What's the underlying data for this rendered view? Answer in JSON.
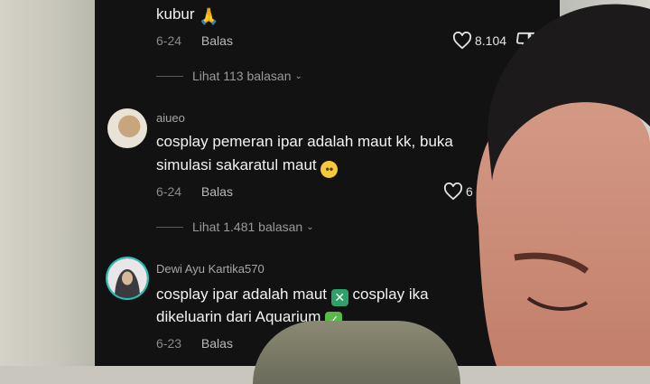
{
  "comments": [
    {
      "text_tail": "kubur",
      "date": "6-24",
      "reply_label": "Balas",
      "likes": "8.104",
      "view_replies": "Lihat 113 balasan"
    },
    {
      "username": "aiueo",
      "line1": "cosplay pemeran ipar adalah maut kk, buka",
      "line2": "simulasi sakaratul maut",
      "date": "6-24",
      "reply_label": "Balas",
      "likes": "6",
      "view_replies": "Lihat 1.481 balasan"
    },
    {
      "username": "Dewi Ayu Kartika570",
      "line1_a": "cosplay ipar adalah maut",
      "line1_b": "cosplay ika",
      "line2": "dikeluarin dari Aquarium",
      "date": "6-23",
      "reply_label": "Balas"
    }
  ],
  "icons": {
    "like": "heart-icon",
    "dislike": "thumbs-down-icon",
    "expand": "chevron-down-icon"
  },
  "colors": {
    "panel_bg": "#121212",
    "avatar_ring": "#25c2b5"
  }
}
